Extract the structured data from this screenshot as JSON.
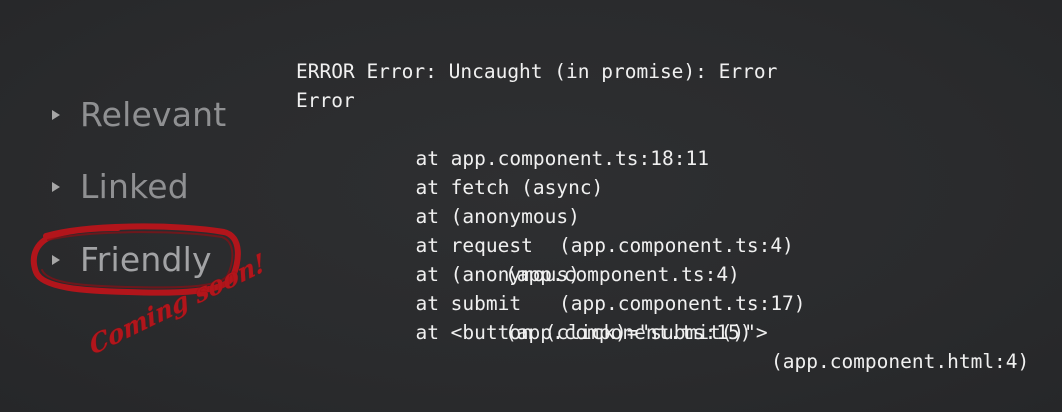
{
  "bullets": [
    {
      "label": "Relevant"
    },
    {
      "label": "Linked"
    },
    {
      "label": "Friendly"
    }
  ],
  "annotation": {
    "coming_soon": "Coming soon!",
    "color": "#b2151b"
  },
  "console": {
    "header": "ERROR Error: Uncaught (in promise): Error",
    "error": "Error",
    "frames": [
      {
        "call": "at app.component.ts:18:11",
        "location": ""
      },
      {
        "call": "at fetch (async)",
        "location": ""
      },
      {
        "call": "at (anonymous)",
        "location": "(app.component.ts:4)"
      },
      {
        "call": "at request",
        "location": "(app.component.ts:4)"
      },
      {
        "call": "at (anonymous)",
        "location": "(app.component.ts:17)"
      },
      {
        "call": "at submit",
        "location": "(app.component.ts:15)"
      },
      {
        "call": "at <button (click)=\"submit()\">",
        "location": "(app.component.html:4)"
      }
    ]
  },
  "colors": {
    "background": "#2b2c2e",
    "bullet_text": "#8f9092",
    "console_text": "#f0f0f0",
    "highlight": "#b2151b"
  }
}
